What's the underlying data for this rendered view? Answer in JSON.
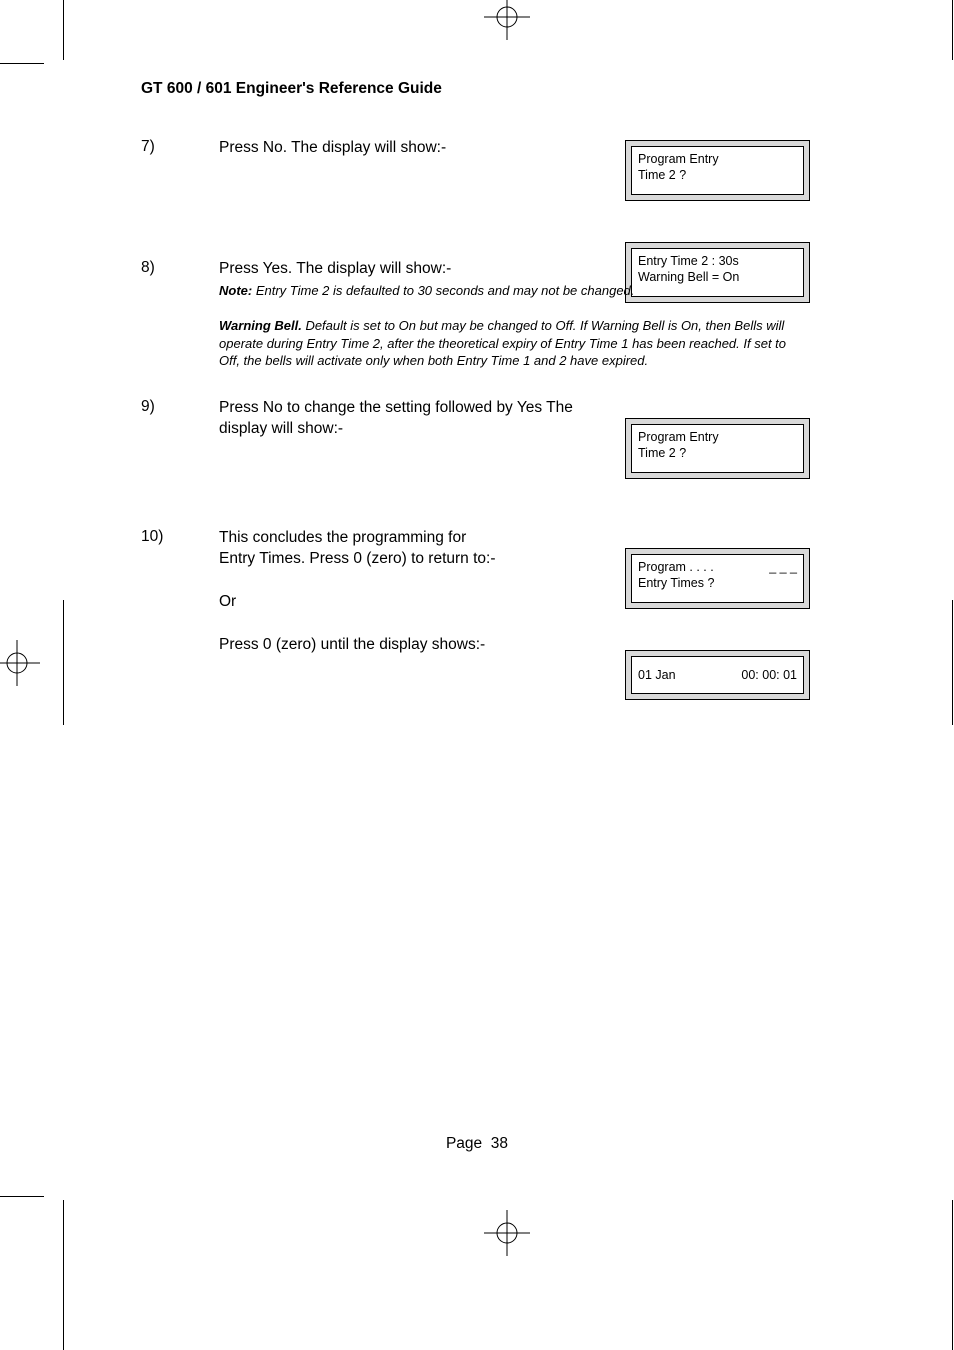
{
  "header": {
    "title": "GT 600 / 601 Engineer's Reference Guide"
  },
  "steps": {
    "s7": {
      "n": "7)",
      "text": "Press No. The display will show:-"
    },
    "s8": {
      "n": "8)",
      "text": "Press Yes. The display will show:-",
      "note_label": "Note:",
      "note_text": " Entry Time 2 is defaulted to 30 seconds and may not be changed."
    },
    "warn": {
      "label": "Warning Bell.",
      "text": " Default is set to On but may be changed to Off. If Warning Bell is On, then Bells will operate during Entry Time 2, after the theoretical expiry of Entry Time 1 has been reached. If set to Off, the bells will activate only when both Entry Time 1 and 2 have expired."
    },
    "s9": {
      "n": "9)",
      "text": "Press No to change the setting followed by Yes The display will show:-"
    },
    "s10": {
      "n": "10)",
      "line1": "This concludes the programming for",
      "line2": "Entry Times. Press 0 (zero) to return to:-",
      "or": "Or",
      "line3": "Press 0 (zero) until the display shows:-"
    }
  },
  "lcd": {
    "b1": {
      "l1": "Program Entry",
      "l2": "Time 2 ?"
    },
    "b2": {
      "l1": "Entry Time 2 : 30s",
      "l2": "Warning Bell = On"
    },
    "b3": {
      "l1": "Program Entry",
      "l2": "Time 2 ?"
    },
    "b4": {
      "left": "Program . . . .",
      "right": "_ _ _",
      "l2": "Entry Times ?"
    },
    "b5": {
      "left": "01 Jan",
      "right": "00: 00: 01"
    }
  },
  "footer": {
    "page_label": "Page",
    "page_no": "38"
  }
}
